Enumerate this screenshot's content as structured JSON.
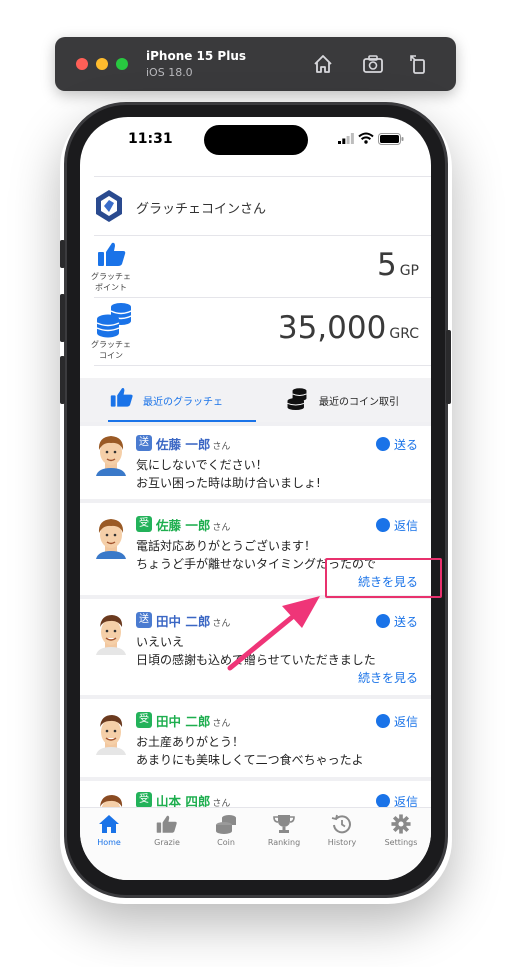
{
  "simulator": {
    "device_name": "iPhone 15 Plus",
    "os_version": "iOS 18.0"
  },
  "status_bar": {
    "time": "11:31"
  },
  "profile": {
    "user_name": "グラッチェコインさん"
  },
  "stats": [
    {
      "icon": "thumbs-up-icon",
      "label_line1": "グラッチェ",
      "label_line2": "ポイント",
      "value": "5",
      "unit": "GP"
    },
    {
      "icon": "coin-stack-icon",
      "label_line1": "グラッチェ",
      "label_line2": "コイン",
      "value": "35,000",
      "unit": "GRC"
    }
  ],
  "tabs": [
    {
      "label": "最近のグラッチェ",
      "active": true
    },
    {
      "label": "最近のコイン取引",
      "active": false
    }
  ],
  "feed": [
    {
      "type_badge": "送",
      "sender": "佐藤 一郎",
      "honorific": "さん",
      "action": "送る",
      "lines": [
        "気にしないでください！",
        "お互い困った時は助け合いましょ!"
      ],
      "more": ""
    },
    {
      "type_badge": "受",
      "sender": "佐藤 一郎",
      "honorific": "さん",
      "action": "返信",
      "lines": [
        "電話対応ありがとうございます！",
        "ちょうど手が離せないタイミングだったので"
      ],
      "more": "続きを見る"
    },
    {
      "type_badge": "送",
      "sender": "田中 二郎",
      "honorific": "さん",
      "action": "送る",
      "lines": [
        "いえいえ",
        "日頃の感謝も込めて贈らせていただきました"
      ],
      "more": "続きを見る"
    },
    {
      "type_badge": "受",
      "sender": "田中 二郎",
      "honorific": "さん",
      "action": "返信",
      "lines": [
        "お土産ありがとう！",
        "あまりにも美味しくて二つ食べちゃったよ"
      ],
      "more": ""
    },
    {
      "type_badge": "受",
      "sender": "山本 四郎",
      "honorific": "さん",
      "action": "返信",
      "lines": [],
      "more": ""
    }
  ],
  "bottom_nav": [
    {
      "label": "Home",
      "icon": "home-icon",
      "active": true
    },
    {
      "label": "Grazie",
      "icon": "thumbs-up-icon",
      "active": false
    },
    {
      "label": "Coin",
      "icon": "coin-stack-icon",
      "active": false
    },
    {
      "label": "Ranking",
      "icon": "trophy-icon",
      "active": false
    },
    {
      "label": "History",
      "icon": "history-icon",
      "active": false
    },
    {
      "label": "Settings",
      "icon": "gear-icon",
      "active": false
    }
  ],
  "colors": {
    "accent": "#1a73e8",
    "send_badge": "#4a7bd0",
    "receive_badge": "#23b25a",
    "highlight": "#e8316d"
  }
}
